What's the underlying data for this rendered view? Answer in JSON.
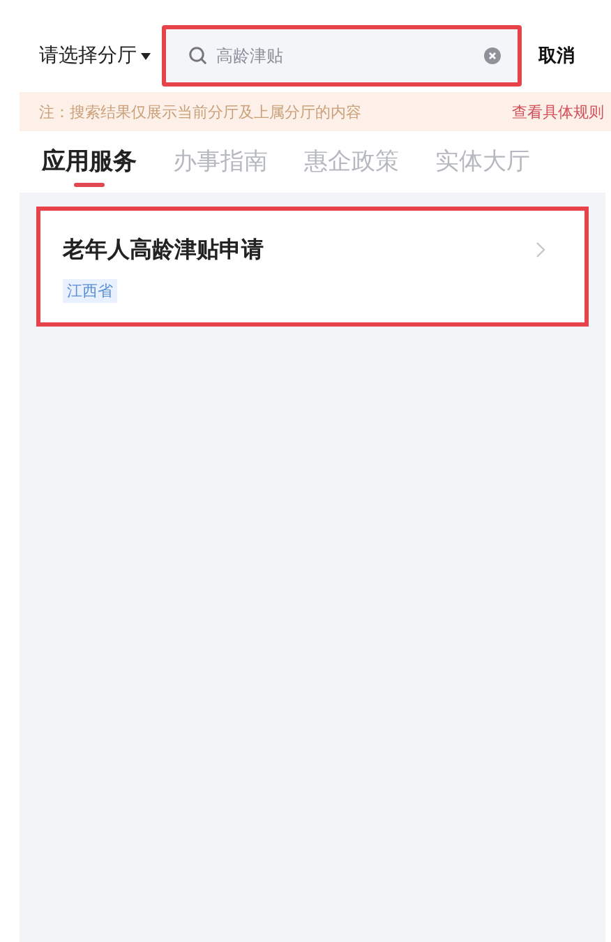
{
  "header": {
    "branch_picker": "请选择分厅",
    "search": {
      "value": "高龄津贴",
      "highlighted": true
    },
    "cancel": "取消"
  },
  "notice": {
    "text": "注：搜索结果仅展示当前分厅及上属分厅的内容",
    "link": "查看具体规则"
  },
  "tabs": [
    {
      "label": "应用服务",
      "selected": true
    },
    {
      "label": "办事指南",
      "selected": false
    },
    {
      "label": "惠企政策",
      "selected": false
    },
    {
      "label": "实体大厅",
      "selected": false
    }
  ],
  "results": [
    {
      "title": "老年人高龄津贴申请",
      "tag": "江西省",
      "highlighted": true
    }
  ]
}
